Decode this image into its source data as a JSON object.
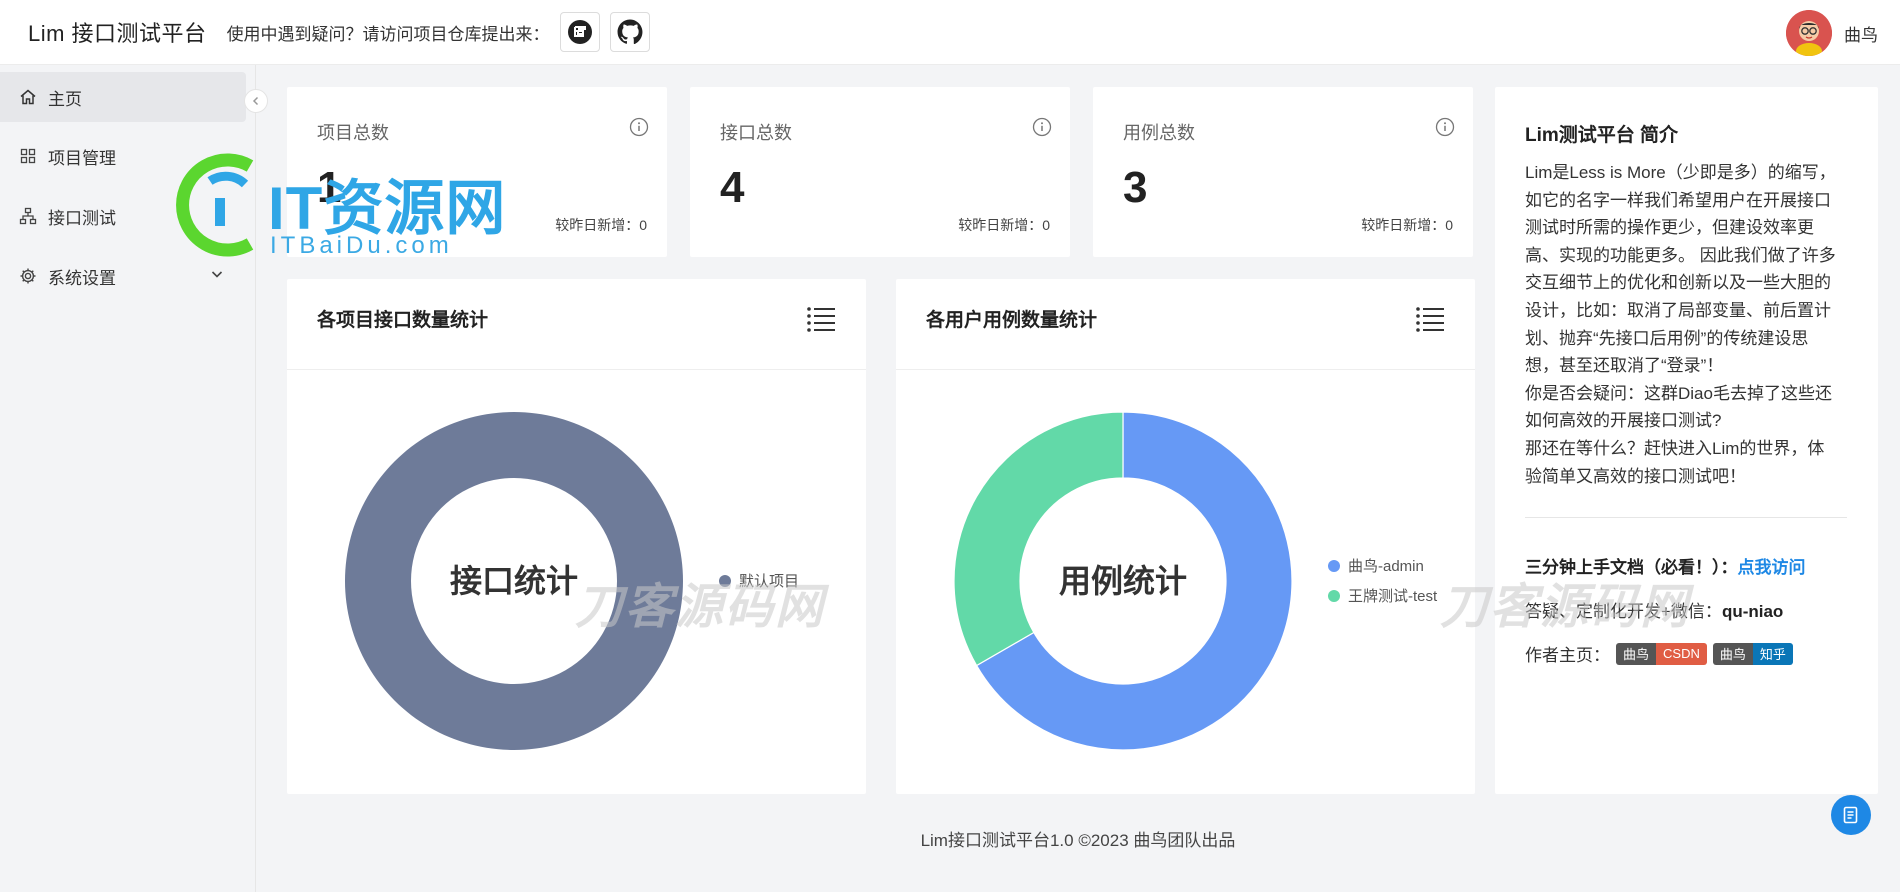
{
  "header": {
    "app_title": "Lim 接口测试平台",
    "help_text": "使用中遇到疑问？请访问项目仓库提出来：",
    "repo_buttons": [
      "gitee-icon",
      "github-icon"
    ],
    "username": "曲鸟"
  },
  "sidebar": {
    "items": [
      {
        "label": "主页",
        "icon": "home-icon",
        "active": true
      },
      {
        "label": "项目管理",
        "icon": "grid-icon",
        "active": false
      },
      {
        "label": "接口测试",
        "icon": "sitemap-icon",
        "active": false
      },
      {
        "label": "系统设置",
        "icon": "gear-icon",
        "active": false,
        "expandable": true
      }
    ]
  },
  "stats": [
    {
      "label": "项目总数",
      "value": "1",
      "delta": "较昨日新增：0"
    },
    {
      "label": "接口总数",
      "value": "4",
      "delta": "较昨日新增：0"
    },
    {
      "label": "用例总数",
      "value": "3",
      "delta": "较昨日新增：0"
    }
  ],
  "charts": {
    "project": {
      "title": "各项目接口数量统计",
      "center_label": "接口统计"
    },
    "user": {
      "title": "各用户用例数量统计",
      "center_label": "用例统计"
    }
  },
  "chart_data": [
    {
      "type": "pie",
      "title": "各项目接口数量统计",
      "center_label": "接口统计",
      "categories": [
        "默认项目"
      ],
      "values": [
        4
      ],
      "colors": [
        "#6e7b99"
      ],
      "legend": "right"
    },
    {
      "type": "pie",
      "title": "各用户用例数量统计",
      "center_label": "用例统计",
      "categories": [
        "曲鸟-admin",
        "王牌测试-test"
      ],
      "values": [
        2,
        1
      ],
      "colors": [
        "#6699f5",
        "#62d9a8"
      ],
      "legend": "right"
    }
  ],
  "intro": {
    "title": "Lim测试平台 简介",
    "body_lines": [
      "Lim是Less is More（少即是多）的缩写，",
      "如它的名字一样我们希望用户在开展接口",
      "测试时所需的操作更少，但建设效率更",
      "高、实现的功能更多。 因此我们做了许多",
      "交互细节上的优化和创新以及一些大胆的",
      "设计，比如：取消了局部变量、前后置计",
      "划、抛弃“先接口后用例”的传统建设思",
      "想，甚至还取消了“登录”！",
      "你是否会疑问：这群Diao毛去掉了这些还",
      "如何高效的开展接口测试?",
      "那还在等什么？赶快进入Lim的世界，体",
      "验简单又高效的接口测试吧！"
    ],
    "doc_prefix": "三分钟上手文档（必看！）：",
    "doc_link": "点我访问",
    "wechat_prefix": "答疑、定制化开发+微信：",
    "wechat_id": "qu-niao",
    "author_prefix": "作者主页：",
    "badges": [
      {
        "left": "曲鸟",
        "right": "CSDN"
      },
      {
        "left": "曲鸟",
        "right": "知乎"
      }
    ]
  },
  "footer": {
    "text": "Lim接口测试平台1.0 ©2023 曲鸟团队出品"
  },
  "watermarks": {
    "brand": "IT资源网",
    "domain": "ITBaiDu.com",
    "text1": "刀客源码网",
    "text2": "刀客源码网"
  },
  "colors": {
    "accent": "#1e88e5",
    "sidebar_active": "#e6e7ea"
  }
}
